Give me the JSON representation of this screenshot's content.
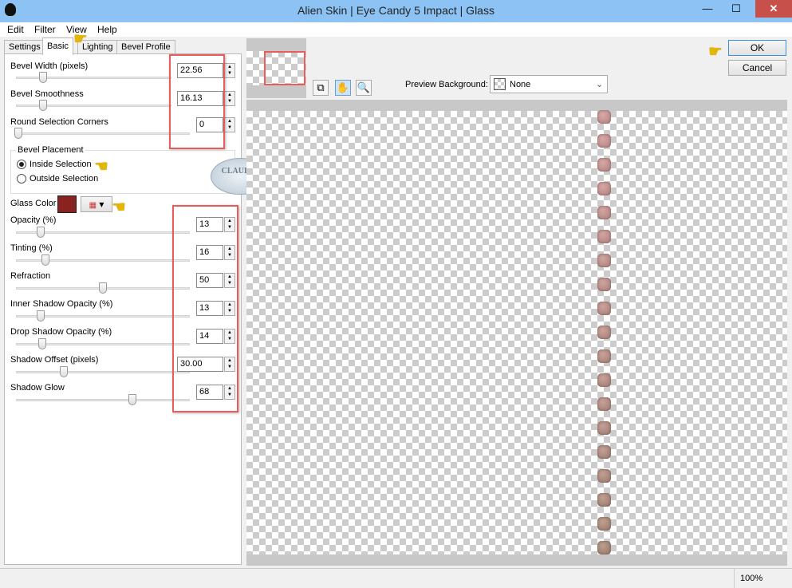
{
  "window": {
    "title": "Alien Skin | Eye Candy 5 Impact | Glass",
    "minimize": "—",
    "maximize": "☐",
    "close": "✕"
  },
  "menu": [
    "Edit",
    "Filter",
    "View",
    "Help"
  ],
  "tabs": [
    "Settings",
    "Basic",
    "Lighting",
    "Bevel Profile"
  ],
  "active_tab": "Basic",
  "basic": {
    "bevel_width": {
      "label": "Bevel Width (pixels)",
      "value": "22.56"
    },
    "bevel_smoothness": {
      "label": "Bevel Smoothness",
      "value": "16.13"
    },
    "round_corners": {
      "label": "Round Selection Corners",
      "value": "0"
    },
    "bevel_placement": {
      "label": "Bevel Placement",
      "options": [
        "Inside Selection",
        "Outside Selection"
      ],
      "selected": "Inside Selection"
    },
    "glass_color": {
      "label": "Glass Color",
      "color": "#8b2222"
    },
    "opacity": {
      "label": "Opacity (%)",
      "value": "13"
    },
    "tinting": {
      "label": "Tinting (%)",
      "value": "16"
    },
    "refraction": {
      "label": "Refraction",
      "value": "50"
    },
    "inner_shadow": {
      "label": "Inner Shadow Opacity (%)",
      "value": "13"
    },
    "drop_shadow": {
      "label": "Drop Shadow Opacity (%)",
      "value": "14"
    },
    "shadow_offset": {
      "label": "Shadow Offset (pixels)",
      "value": "30.00"
    },
    "shadow_glow": {
      "label": "Shadow Glow",
      "value": "68"
    }
  },
  "watermark": "CLAUDIA",
  "preview": {
    "background_label": "Preview Background:",
    "background_value": "None"
  },
  "buttons": {
    "ok": "OK",
    "cancel": "Cancel"
  },
  "status": {
    "zoom": "100%"
  }
}
